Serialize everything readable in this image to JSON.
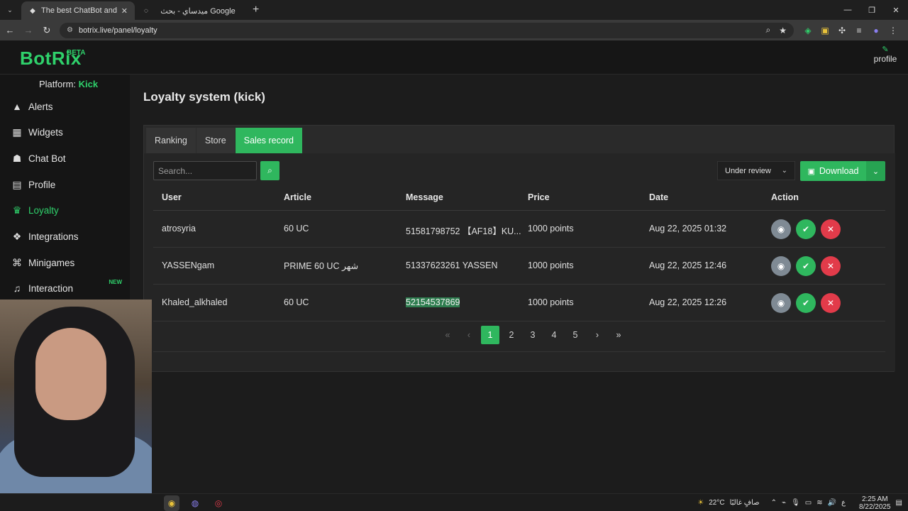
{
  "browser": {
    "tabs": [
      {
        "title": "The best ChatBot and Widgets",
        "active": true
      },
      {
        "title": "ميدساي - بحث Google",
        "active": false
      }
    ],
    "url": "botrix.live/panel/loyalty"
  },
  "header": {
    "logo": "BotRix",
    "beta": "BETA",
    "profile_label": "profile"
  },
  "sidebar": {
    "platform_label": "Platform:",
    "platform_value": "Kick",
    "items": [
      {
        "label": "Alerts",
        "icon": "warning-icon"
      },
      {
        "label": "Widgets",
        "icon": "grid-icon"
      },
      {
        "label": "Chat Bot",
        "icon": "robot-icon"
      },
      {
        "label": "Profile",
        "icon": "id-card-icon"
      },
      {
        "label": "Loyalty",
        "icon": "trophy-icon",
        "active": true
      },
      {
        "label": "Integrations",
        "icon": "cubes-icon"
      },
      {
        "label": "Minigames",
        "icon": "gamepad-icon"
      },
      {
        "label": "Interaction",
        "icon": "music-icon",
        "badge": "NEW"
      }
    ]
  },
  "main": {
    "title": "Loyalty system (kick)",
    "tabs": [
      "Ranking",
      "Store",
      "Sales record"
    ],
    "active_tab": "Sales record",
    "search_placeholder": "Search...",
    "status_filter": "Under review",
    "download_label": "Download",
    "columns": [
      "User",
      "Article",
      "Message",
      "Price",
      "Date",
      "Action"
    ],
    "rows": [
      {
        "user": "atrosyria",
        "article": "60 UC",
        "message": "51581798752 【AF18】KU...",
        "price": "1000 points",
        "date": "Aug 22, 2025 01:32"
      },
      {
        "user": "YASSENgam",
        "article": "PRIME 60 UC شهر",
        "message": "51337623261 YASSEN",
        "price": "1000 points",
        "date": "Aug 22, 2025 12:46"
      },
      {
        "user": "Khaled_alkhaled",
        "article": "60 UC",
        "message": "52154537869",
        "price": "1000 points",
        "date": "Aug 22, 2025 12:26"
      }
    ],
    "pagination": {
      "pages": [
        "1",
        "2",
        "3",
        "4",
        "5"
      ],
      "current": "1"
    }
  },
  "taskbar": {
    "weather": "22°C",
    "weather_text": "صافٍ غالبًا",
    "time": "2:25 AM",
    "date": "8/22/2025",
    "lang": "ع"
  },
  "colors": {
    "accent": "#2fb75e",
    "brand": "#2fd16b",
    "danger": "#e23b4a",
    "muted": "#7f8a94"
  }
}
